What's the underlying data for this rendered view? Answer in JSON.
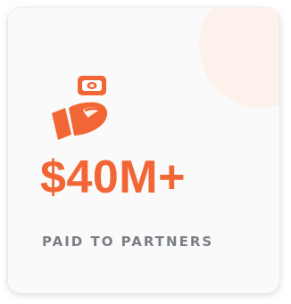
{
  "stat_card": {
    "value": "$40M+",
    "label": "PAID TO PARTNERS",
    "icon": "hand-holding-money-icon",
    "accent_color": "#f26535",
    "label_color": "#7a7f86",
    "background_color": "#fafafa"
  }
}
